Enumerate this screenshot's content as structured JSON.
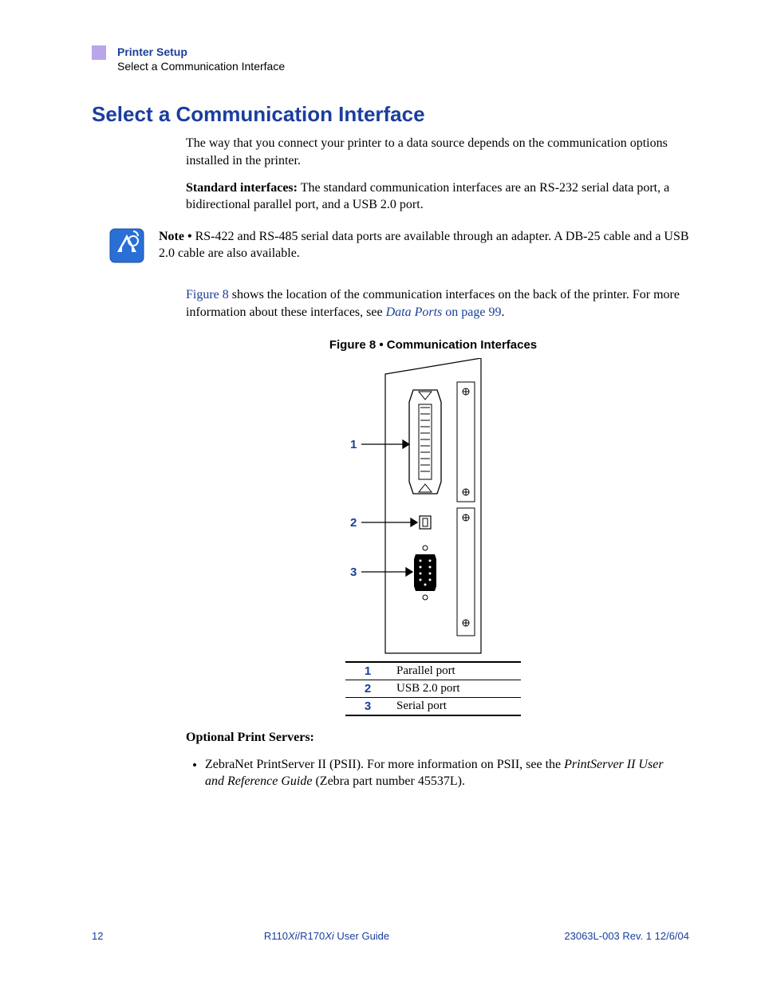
{
  "header": {
    "chapter": "Printer Setup",
    "section": "Select a Communication Interface"
  },
  "title": "Select a Communication Interface",
  "para1": "The way that you connect your printer to a data source depends on the communication options installed in the printer.",
  "para2_label": "Standard interfaces:",
  "para2_body": " The standard communication interfaces are an RS-232 serial data port, a bidirectional parallel port, and a USB 2.0 port.",
  "note_label": "Note •",
  "note_body": " RS-422 and RS-485 serial data ports are available through an adapter. A DB-25 cable and a USB 2.0 cable are also available.",
  "para3_link": "Figure 8",
  "para3_a": " shows the location of the communication interfaces on the back of the printer. For more information about these interfaces, see ",
  "para3_link2": "Data Ports",
  "para3_b": " on page 99",
  "para3_c": ".",
  "figure_caption": "Figure 8 • Communication Interfaces",
  "callouts": {
    "1": "1",
    "2": "2",
    "3": "3"
  },
  "legend": [
    {
      "num": "1",
      "label": "Parallel port"
    },
    {
      "num": "2",
      "label": "USB 2.0 port"
    },
    {
      "num": "3",
      "label": "Serial port"
    }
  ],
  "optional_head": "Optional Print Servers:",
  "bullet1_a": "ZebraNet PrintServer II (PSII). For more information on PSII, see the ",
  "bullet1_ital": "PrintServer II User and Reference Guide",
  "bullet1_b": " (Zebra part number 45537L).",
  "footer": {
    "page": "12",
    "center_a": "R110",
    "center_i1": "Xi",
    "center_b": "/R170",
    "center_i2": "Xi",
    "center_c": " User Guide",
    "right": "23063L-003 Rev. 1   12/6/04"
  }
}
